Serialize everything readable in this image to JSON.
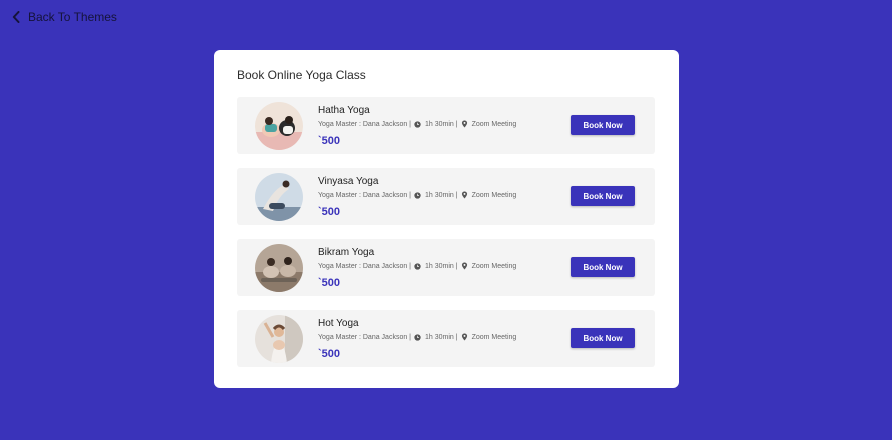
{
  "nav": {
    "back_label": "Back To Themes"
  },
  "card": {
    "title": "Book Online Yoga Class"
  },
  "classes": [
    {
      "name": "Hatha Yoga",
      "master": "Yoga Master : Dana Jackson |",
      "duration": "1h 30min |",
      "location": "Zoom Meeting",
      "price": "`500",
      "button": "Book Now"
    },
    {
      "name": "Vinyasa Yoga",
      "master": "Yoga Master : Dana Jackson |",
      "duration": "1h 30min |",
      "location": "Zoom Meeting",
      "price": "`500",
      "button": "Book Now"
    },
    {
      "name": "Bikram Yoga",
      "master": "Yoga Master : Dana Jackson |",
      "duration": "1h 30min |",
      "location": "Zoom Meeting",
      "price": "`500",
      "button": "Book Now"
    },
    {
      "name": "Hot Yoga",
      "master": "Yoga Master : Dana Jackson |",
      "duration": "1h 30min |",
      "location": "Zoom Meeting",
      "price": "`500",
      "button": "Book Now"
    }
  ],
  "colors": {
    "background": "#3a33ba",
    "accent": "#3a33ba",
    "card": "#ffffff",
    "item_bg": "#f4f4f4"
  },
  "icons": {
    "back": "chevron-left-icon",
    "duration": "clock-icon",
    "location": "location-pin-icon"
  }
}
